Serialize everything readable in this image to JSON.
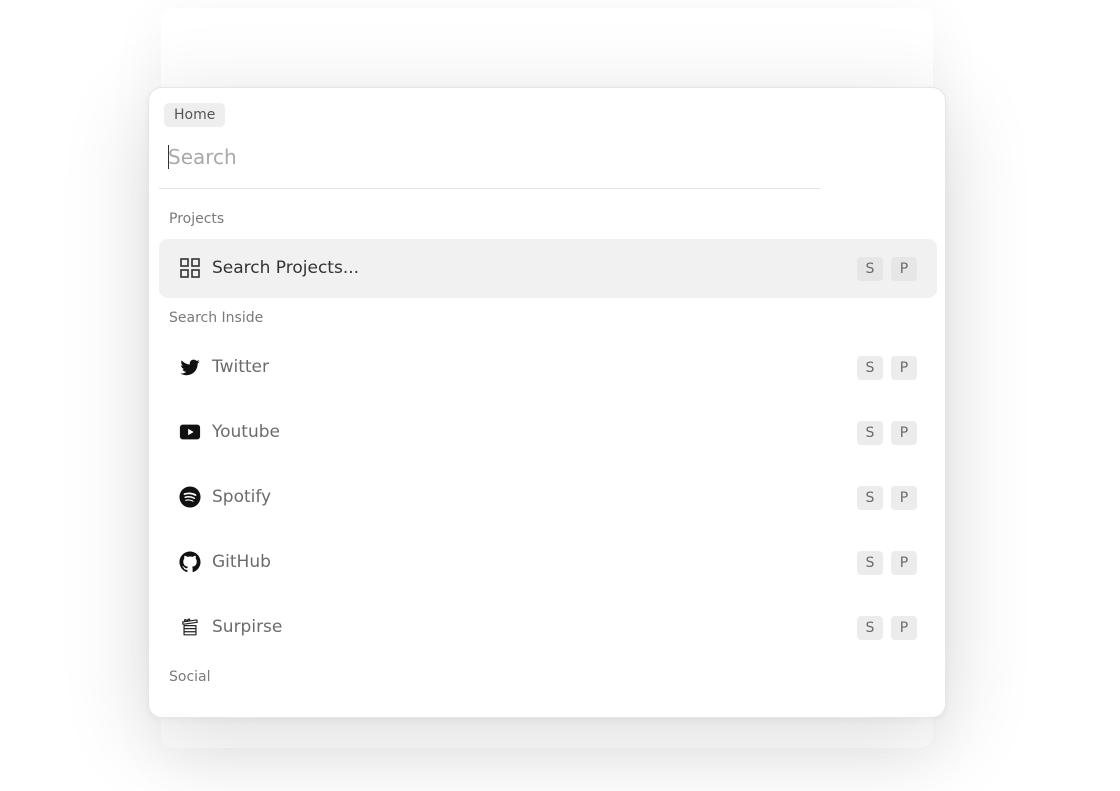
{
  "breadcrumb": {
    "label": "Home"
  },
  "search": {
    "placeholder": "Search",
    "value": ""
  },
  "groups": [
    {
      "heading": "Projects",
      "items": [
        {
          "label": "Search Projects...",
          "icon": "grid-icon",
          "shortcut": [
            "S",
            "P"
          ],
          "active": true
        }
      ]
    },
    {
      "heading": "Search Inside",
      "items": [
        {
          "label": "Twitter",
          "icon": "twitter-icon",
          "shortcut": [
            "S",
            "P"
          ]
        },
        {
          "label": "Youtube",
          "icon": "youtube-icon",
          "shortcut": [
            "S",
            "P"
          ]
        },
        {
          "label": "Spotify",
          "icon": "spotify-icon",
          "shortcut": [
            "S",
            "P"
          ]
        },
        {
          "label": "GitHub",
          "icon": "github-icon",
          "shortcut": [
            "S",
            "P"
          ]
        },
        {
          "label": "Surpirse",
          "icon": "gift-icon",
          "shortcut": [
            "S",
            "P"
          ]
        }
      ]
    },
    {
      "heading": "Social",
      "items": []
    }
  ]
}
